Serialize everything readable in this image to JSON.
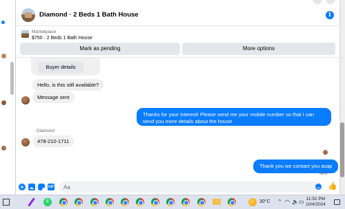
{
  "header": {
    "title": "Diamond · 2 Beds 1 Bath House"
  },
  "listing": {
    "source": "Marketplace",
    "description": "$750 · 2 Beds 1 Bath House",
    "mark_pending_label": "Mark as pending",
    "more_options_label": "More options"
  },
  "messages": {
    "buyer_details_label": "Buyer details",
    "m1": "Hello, is this still available?",
    "m2": "Message sent",
    "m3": "Thanks for your interest! Please send me your mobile number so that I can send you more details about the house",
    "sender_name": "Diamond",
    "m4": "478-210-1711",
    "m5": "Thank you we contact you asap",
    "sent_status": "Sent"
  },
  "composer": {
    "placeholder": "Aa",
    "gif_label": "GIF"
  },
  "taskbar": {
    "temperature": "30°C",
    "time": "11:52 PM",
    "date": "10/4/2024"
  },
  "colors": {
    "accent": "#0a7cff",
    "bubble_in": "#f0f0f0"
  }
}
